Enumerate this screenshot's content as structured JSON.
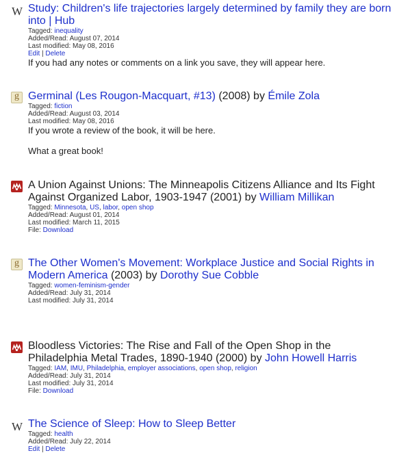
{
  "labels": {
    "tagged": "Tagged: ",
    "added": "Added/Read: ",
    "modified": "Last modified: ",
    "file": "File: ",
    "by": " by ",
    "edit": "Edit",
    "separator": " | ",
    "delete": "Delete",
    "comma": ", "
  },
  "entries": [
    {
      "icon": "wikipedia-w-icon",
      "title": "Study: Children's life trajectories largely determined by family they are born into | Hub",
      "tags": [
        "inequality"
      ],
      "added": "August 07, 2014",
      "modified": "May 08, 2016",
      "note": "If you had any notes or comments on a link you save, they will appear here."
    },
    {
      "icon": "goodreads-g-icon",
      "title": "Germinal (Les Rougon-Macquart, #13)",
      "year": " (2008)",
      "author": "Émile Zola",
      "tags": [
        "fiction"
      ],
      "added": "August 03, 2014",
      "modified": "May 08, 2016",
      "note": "If you wrote a review of the book, it will be here.",
      "note2": "What a great book!"
    },
    {
      "icon": "mendeley-icon",
      "title": "A Union Against Unions: The Minneapolis Citizens Alliance and Its Fight Against Organized Labor, 1903-1947",
      "year": " (2001)",
      "author": "William Millikan",
      "tags": [
        "Minnesota",
        "US",
        "labor",
        "open shop"
      ],
      "added": "August 01, 2014",
      "modified": "March 11, 2015",
      "file": "Download"
    },
    {
      "icon": "goodreads-g-icon",
      "title": "The Other Women's Movement: Workplace Justice and Social Rights in Modern America",
      "year": " (2003)",
      "author": "Dorothy Sue Cobble",
      "tags": [
        "women-feminism-gender"
      ],
      "added": "July 31, 2014",
      "modified": "July 31, 2014"
    },
    {
      "icon": "mendeley-icon",
      "title": "Bloodless Victories: The Rise and Fall of the Open Shop in the Philadelphia Metal Trades, 1890-1940",
      "year": " (2000)",
      "author": "John Howell Harris",
      "tags": [
        "IAM",
        "IMU",
        "Philadelphia",
        "employer associations",
        "open shop",
        "religion"
      ],
      "added": "July 31, 2014",
      "modified": "July 31, 2014",
      "file": "Download"
    },
    {
      "icon": "wikipedia-w-icon",
      "title": "The Science of Sleep: How to Sleep Better",
      "tags": [
        "health"
      ],
      "added": "July 22, 2014"
    }
  ]
}
